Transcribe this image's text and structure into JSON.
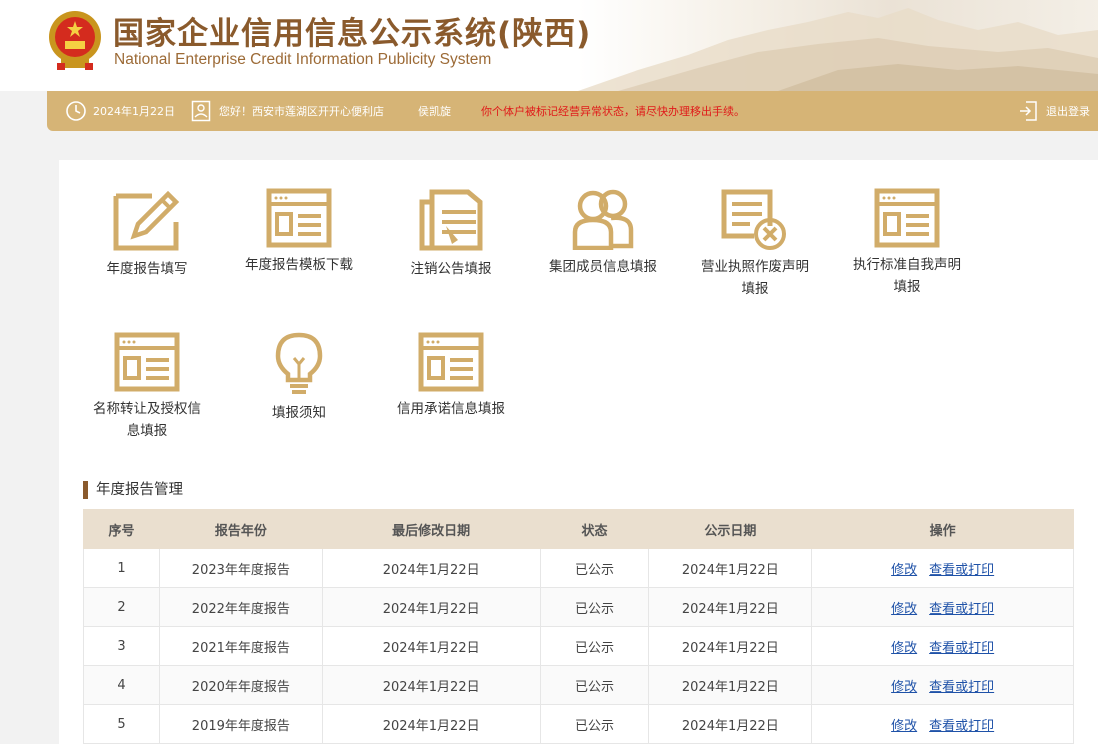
{
  "header": {
    "title": "国家企业信用信息公示系统(陕西)",
    "subtitle": "National Enterprise Credit Information Publicity System"
  },
  "infobar": {
    "date": "2024年1月22日",
    "greeting": "您好！西安市莲湖区开开心便利店",
    "user": "侯凯旋",
    "warning": "你个体户被标记经营异常状态，请尽快办理移出手续。",
    "logout": "退出登录",
    "warning_color": "#e01a1a",
    "bar_color": "#d6b476"
  },
  "tiles": [
    {
      "label": "年度报告填写",
      "icon": "edit-form-icon"
    },
    {
      "label": "年度报告模板下载",
      "icon": "template-download-icon"
    },
    {
      "label": "注销公告填报",
      "icon": "cancellation-notice-icon"
    },
    {
      "label": "集团成员信息填报",
      "icon": "group-members-icon"
    },
    {
      "label": "营业执照作废声明填报",
      "icon": "license-void-icon"
    },
    {
      "label": "执行标准自我声明填报",
      "icon": "standard-declaration-icon"
    },
    {
      "label": "名称转让及授权信息填报",
      "icon": "name-transfer-icon"
    },
    {
      "label": "填报须知",
      "icon": "lightbulb-icon"
    },
    {
      "label": "信用承诺信息填报",
      "icon": "credit-commitment-icon"
    }
  ],
  "section": {
    "title": "年度报告管理"
  },
  "table": {
    "headers": [
      "序号",
      "报告年份",
      "最后修改日期",
      "状态",
      "公示日期",
      "操作"
    ],
    "rows": [
      {
        "no": "1",
        "year": "2023年年度报告",
        "modified": "2024年1月22日",
        "status": "已公示",
        "published": "2024年1月22日",
        "edit": "修改",
        "view": "查看或打印"
      },
      {
        "no": "2",
        "year": "2022年年度报告",
        "modified": "2024年1月22日",
        "status": "已公示",
        "published": "2024年1月22日",
        "edit": "修改",
        "view": "查看或打印"
      },
      {
        "no": "3",
        "year": "2021年年度报告",
        "modified": "2024年1月22日",
        "status": "已公示",
        "published": "2024年1月22日",
        "edit": "修改",
        "view": "查看或打印"
      },
      {
        "no": "4",
        "year": "2020年年度报告",
        "modified": "2024年1月22日",
        "status": "已公示",
        "published": "2024年1月22日",
        "edit": "修改",
        "view": "查看或打印"
      },
      {
        "no": "5",
        "year": "2019年年度报告",
        "modified": "2024年1月22日",
        "status": "已公示",
        "published": "2024年1月22日",
        "edit": "修改",
        "view": "查看或打印"
      }
    ]
  },
  "colors": {
    "accent": "#d1ac69",
    "brand": "#8a5a2c",
    "link": "#1f52a8"
  }
}
